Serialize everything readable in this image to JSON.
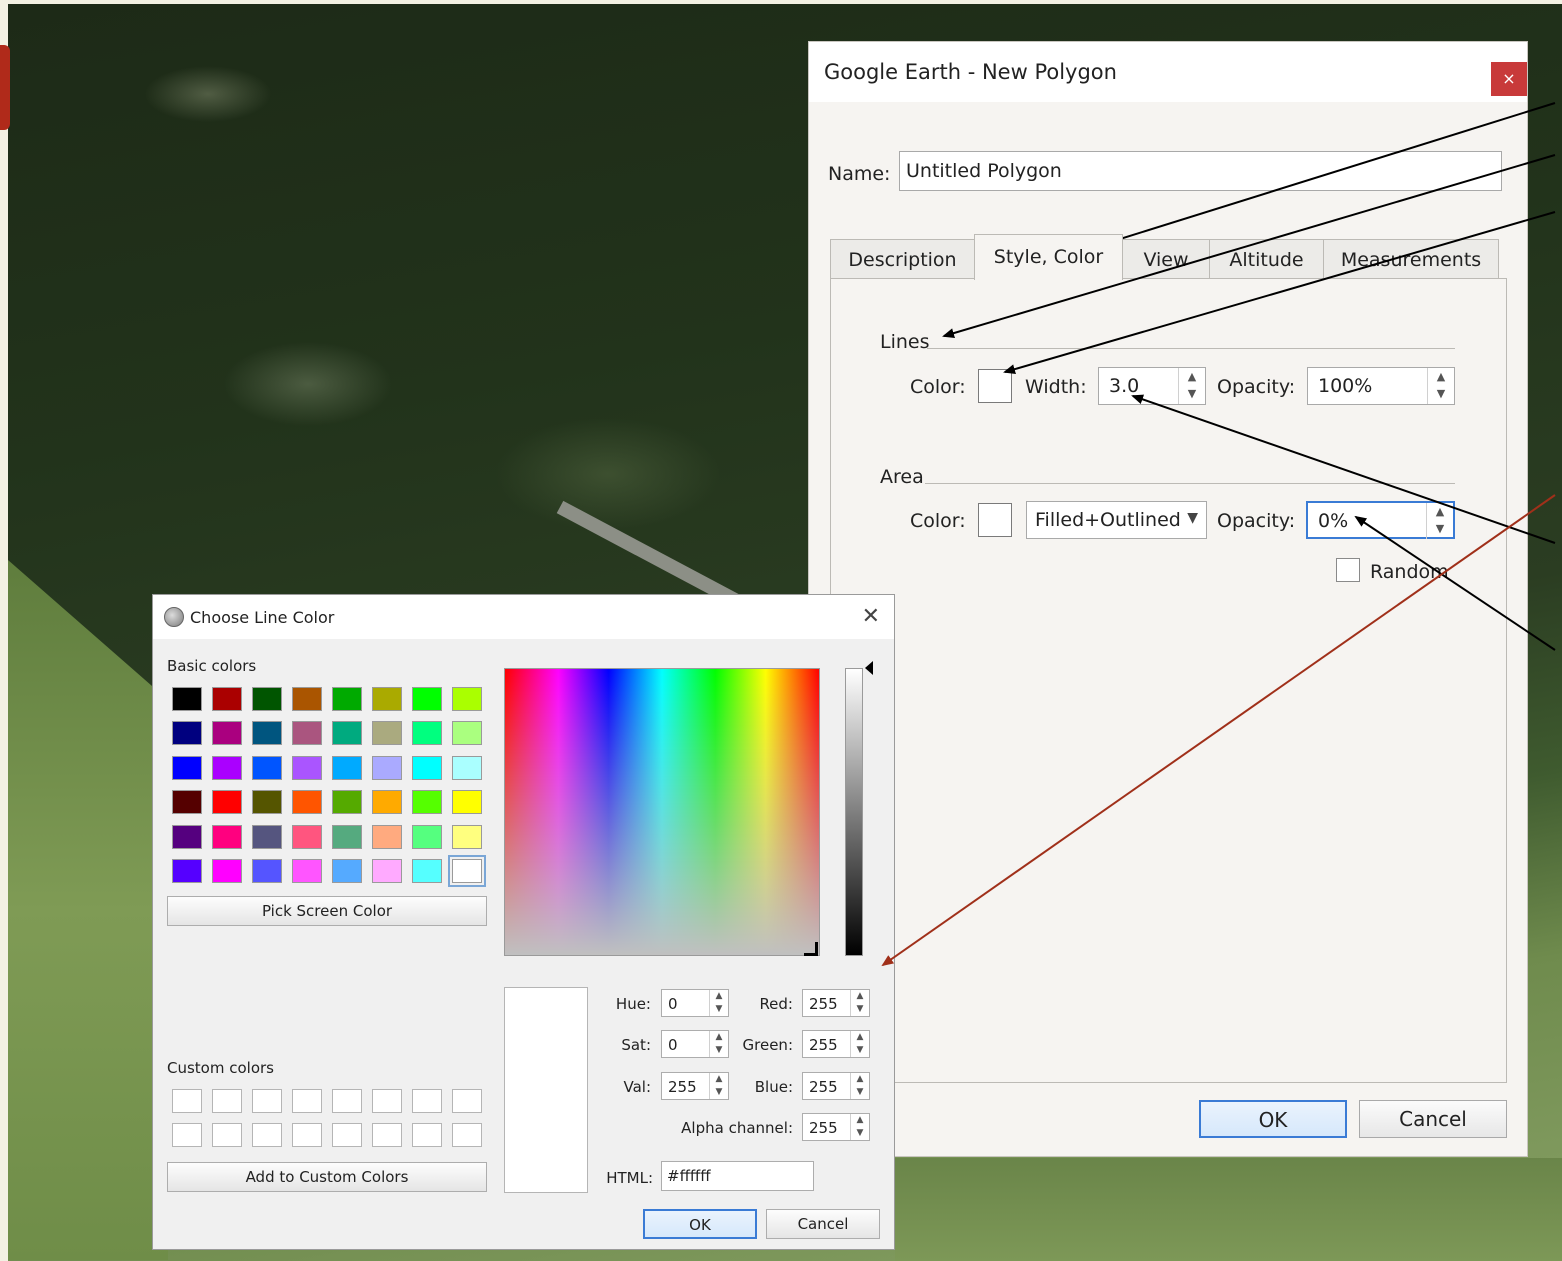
{
  "ge_dialog": {
    "title": "Google Earth - New Polygon",
    "close_glyph": "×",
    "name_label": "Name:",
    "name_value": "Untitled Polygon",
    "tabs": [
      {
        "label": "Description"
      },
      {
        "label": "Style, Color"
      },
      {
        "label": "View"
      },
      {
        "label": "Altitude"
      },
      {
        "label": "Measurements"
      }
    ],
    "active_tab": "Style, Color",
    "lines": {
      "heading": "Lines",
      "color_label": "Color:",
      "width_label": "Width:",
      "width_value": "3.0",
      "opacity_label": "Opacity:",
      "opacity_value": "100%"
    },
    "area": {
      "heading": "Area",
      "color_label": "Color:",
      "mode_value": "Filled+Outlined",
      "opacity_label": "Opacity:",
      "opacity_value": "0%",
      "random_label": "Random"
    },
    "ok_label": "OK",
    "cancel_label": "Cancel"
  },
  "color_dialog": {
    "title": "Choose Line Color",
    "close_glyph": "✕",
    "basic_colors_label": "Basic colors",
    "basic_colors": [
      "#000000",
      "#aa0000",
      "#005500",
      "#aa5500",
      "#00aa00",
      "#aaaa00",
      "#00ff00",
      "#aaff00",
      "#00007f",
      "#aa007f",
      "#00557f",
      "#aa557f",
      "#00aa7f",
      "#aaaa7f",
      "#00ff7f",
      "#aaff7f",
      "#0000ff",
      "#aa00ff",
      "#0055ff",
      "#aa55ff",
      "#00aaff",
      "#aaaaff",
      "#00ffff",
      "#aaffff",
      "#550000",
      "#ff0000",
      "#555500",
      "#ff5500",
      "#55aa00",
      "#ffaa00",
      "#55ff00",
      "#ffff00",
      "#55007f",
      "#ff007f",
      "#55557f",
      "#ff557f",
      "#55aa7f",
      "#ffaa7f",
      "#55ff7f",
      "#ffff7f",
      "#5500ff",
      "#ff00ff",
      "#5555ff",
      "#ff55ff",
      "#55aaff",
      "#ffaaff",
      "#55ffff",
      "#ffffff"
    ],
    "pick_screen_label": "Pick Screen Color",
    "custom_colors_label": "Custom colors",
    "add_custom_label": "Add to Custom Colors",
    "hue_label": "Hue:",
    "hue_value": "0",
    "sat_label": "Sat:",
    "sat_value": "0",
    "val_label": "Val:",
    "val_value": "255",
    "red_label": "Red:",
    "red_value": "255",
    "green_label": "Green:",
    "green_value": "255",
    "blue_label": "Blue:",
    "blue_value": "255",
    "alpha_label": "Alpha channel:",
    "alpha_value": "255",
    "html_label": "HTML:",
    "html_value": "#ffffff",
    "ok_label": "OK",
    "cancel_label": "Cancel"
  },
  "colors": {
    "accent_blue": "#3a7bd5",
    "close_red": "#c83a3a",
    "annotation_black": "#000000",
    "annotation_red": "#a0301a"
  }
}
